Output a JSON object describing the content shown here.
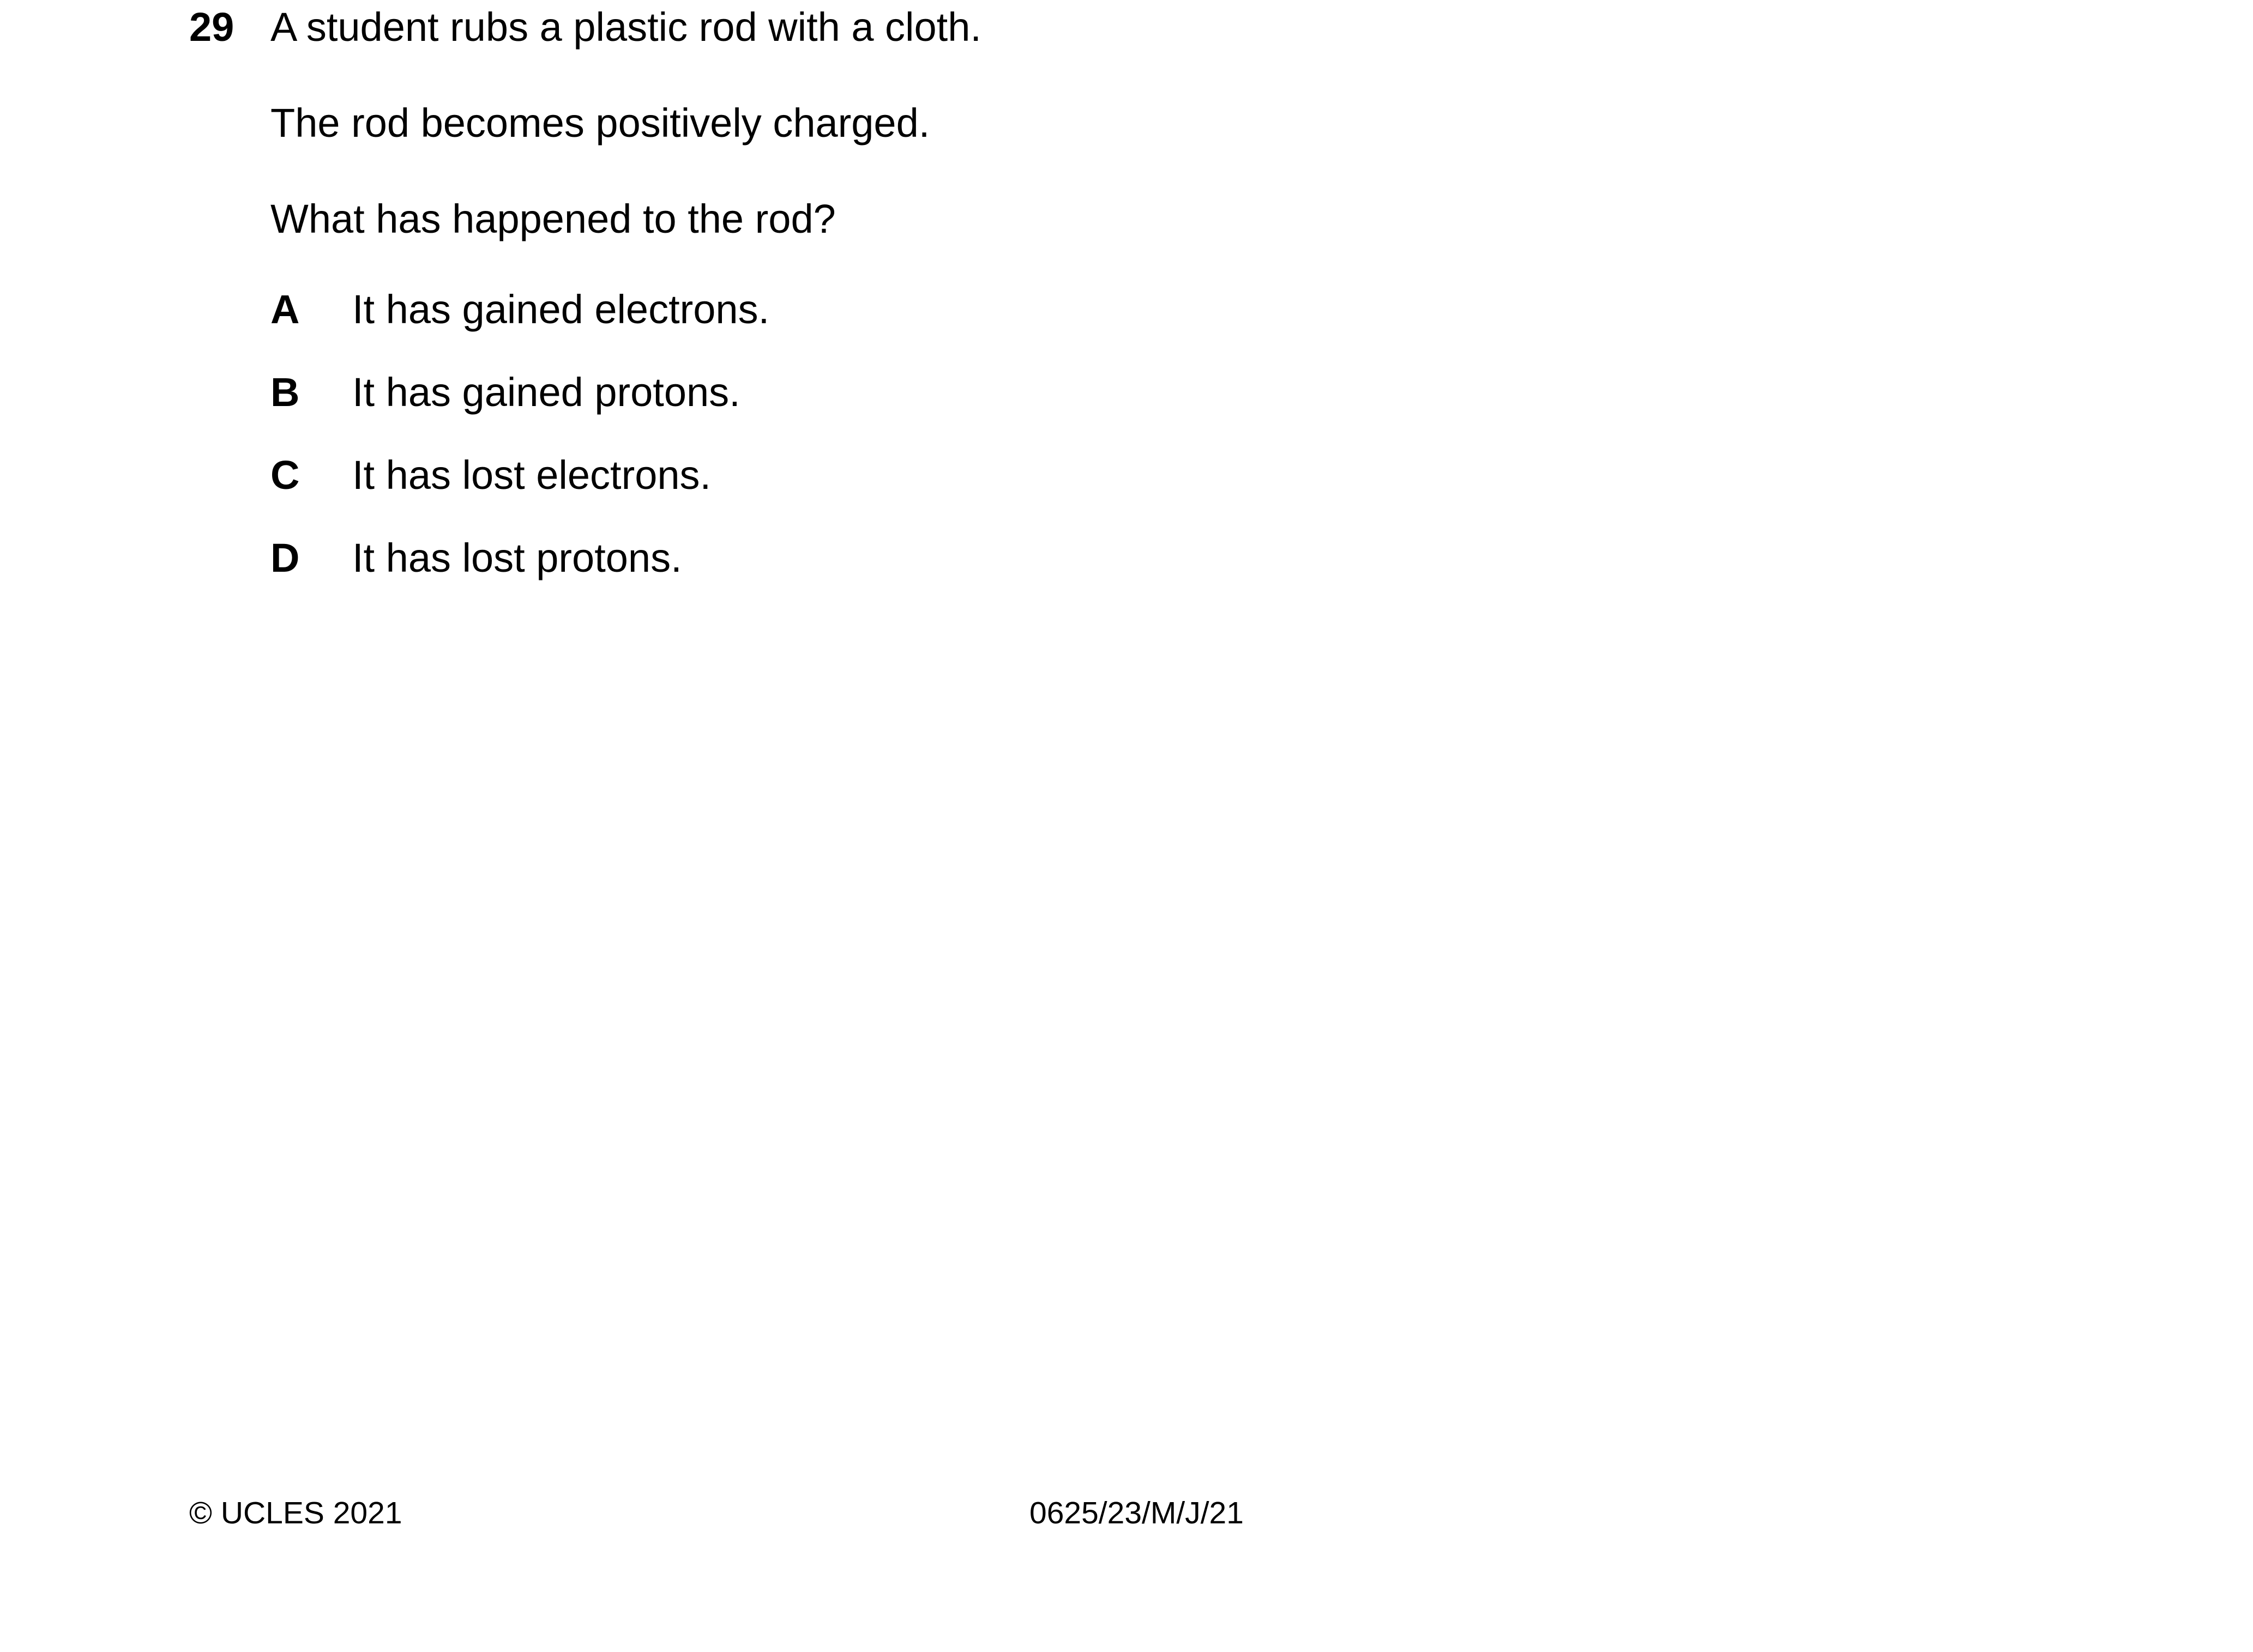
{
  "question": {
    "number": "29",
    "stem": [
      "A student rubs a plastic rod with a cloth.",
      "The rod becomes positively charged.",
      "What has happened to the rod?"
    ],
    "options": [
      {
        "letter": "A",
        "text": "It has gained electrons."
      },
      {
        "letter": "B",
        "text": "It has gained protons."
      },
      {
        "letter": "C",
        "text": "It has lost electrons."
      },
      {
        "letter": "D",
        "text": "It has lost protons."
      }
    ]
  },
  "footer": {
    "copyright": "© UCLES 2021",
    "paper_code": "0625/23/M/J/21"
  }
}
